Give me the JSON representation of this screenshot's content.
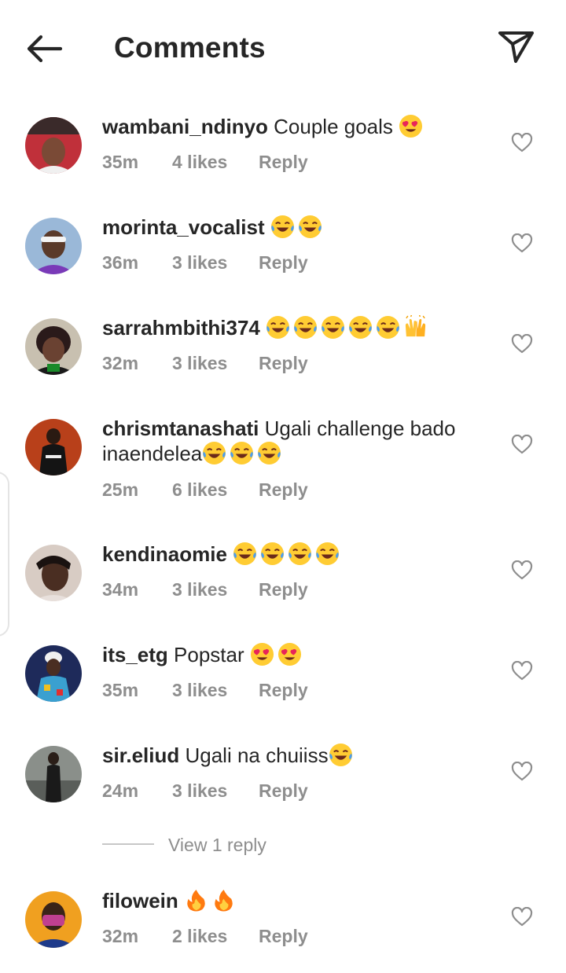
{
  "header": {
    "title": "Comments",
    "back_icon": "arrow-left-icon",
    "share_icon": "paper-plane-icon"
  },
  "comments": [
    {
      "username": "wambani_ndinyo",
      "text": " Couple goals ",
      "emojis": [
        "heart-eyes"
      ],
      "time": "35m",
      "likes": "4 likes",
      "reply": "Reply"
    },
    {
      "username": "morinta_vocalist",
      "text": " ",
      "emojis": [
        "tears-of-joy",
        "tears-of-joy"
      ],
      "time": "36m",
      "likes": "3 likes",
      "reply": "Reply"
    },
    {
      "username": "sarrahmbithi374",
      "text": " ",
      "emojis": [
        "tears-of-joy",
        "tears-of-joy",
        "tears-of-joy",
        "tears-of-joy",
        "tears-of-joy",
        "raising-hands"
      ],
      "time": "32m",
      "likes": "3 likes",
      "reply": "Reply"
    },
    {
      "username": "chrismtanashati",
      "text": " Ugali challenge bado inaendelea",
      "emojis": [
        "tears-of-joy",
        "tears-of-joy",
        "tears-of-joy"
      ],
      "time": "25m",
      "likes": "6 likes",
      "reply": "Reply"
    },
    {
      "username": "kendinaomie",
      "text": " ",
      "emojis": [
        "tears-of-joy",
        "tears-of-joy",
        "tears-of-joy",
        "tears-of-joy"
      ],
      "time": "34m",
      "likes": "3 likes",
      "reply": "Reply"
    },
    {
      "username": "its_etg",
      "text": " Popstar ",
      "emojis": [
        "heart-eyes",
        "heart-eyes"
      ],
      "time": "35m",
      "likes": "3 likes",
      "reply": "Reply"
    },
    {
      "username": "sir.eliud",
      "text": " Ugali na chuiiss",
      "emojis": [
        "tears-of-joy"
      ],
      "time": "24m",
      "likes": "3 likes",
      "reply": "Reply"
    },
    {
      "username": "filowein",
      "text": " ",
      "emojis": [
        "fire",
        "fire"
      ],
      "time": "32m",
      "likes": "2 likes",
      "reply": "Reply"
    }
  ],
  "view_replies": {
    "label": "View 1 reply"
  },
  "colors": {
    "text": "#262626",
    "meta": "#8e8e8e",
    "divider": "#c7c7c7"
  }
}
